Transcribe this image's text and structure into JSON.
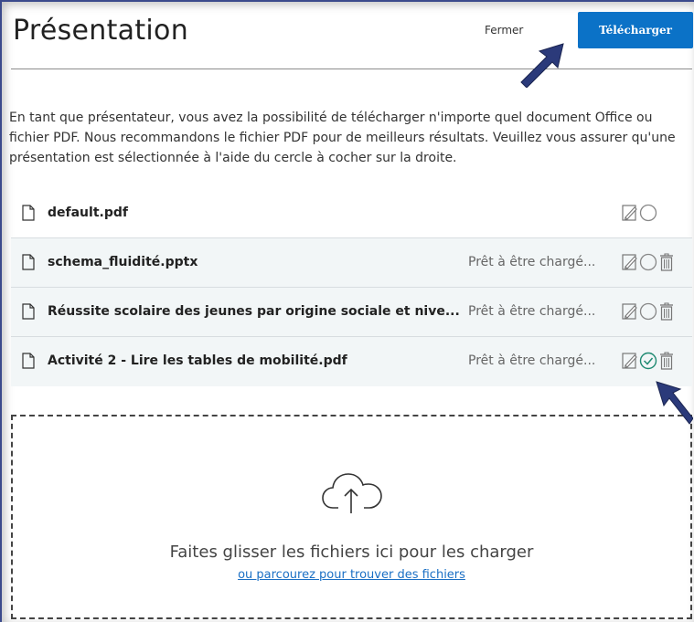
{
  "header": {
    "title": "Présentation",
    "close_label": "Fermer",
    "upload_label": "Télécharger"
  },
  "description": "En tant que présentateur, vous avez la possibilité de télécharger n'importe quel document Office ou fichier PDF. Nous recommandons le fichier PDF pour de meilleurs résultats. Veuillez vous assurer qu'une présentation est sélectionnée à l'aide du cercle à cocher sur la droite.",
  "files": [
    {
      "name": "default.pdf",
      "status": "",
      "selected": false,
      "deletable": false
    },
    {
      "name": "schema_fluidité.pptx",
      "status": "Prêt à être chargé...",
      "selected": false,
      "deletable": true
    },
    {
      "name": "Réussite scolaire des jeunes par origine sociale et nive...",
      "status": "Prêt à être chargé...",
      "selected": false,
      "deletable": true
    },
    {
      "name": "Activité 2 - Lire les tables de mobilité.pdf",
      "status": "Prêt à être chargé...",
      "selected": true,
      "deletable": true
    }
  ],
  "dropzone": {
    "text": "Faites glisser les fichiers ici pour les charger",
    "link": "ou parcourez pour trouver des fichiers"
  },
  "colors": {
    "accent": "#0b72c7",
    "selected_check": "#1f8a72",
    "annotation_arrow": "#2b3a7a"
  },
  "icons": [
    "document-icon",
    "edit-icon",
    "select-circle-icon",
    "trash-icon",
    "cloud-upload-icon",
    "pointer-arrow-icon"
  ]
}
